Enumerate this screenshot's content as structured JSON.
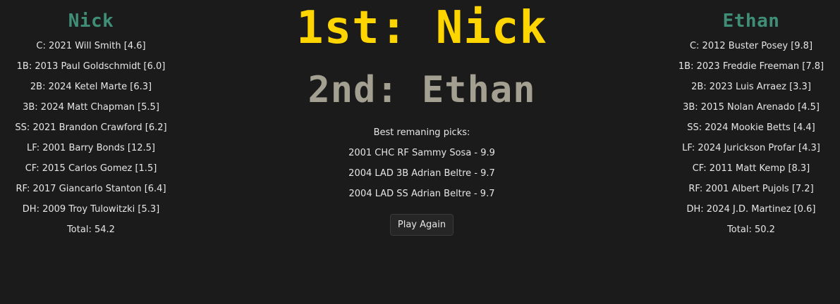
{
  "colors": {
    "background": "#1b1b1b",
    "text": "#e6e6e6",
    "player_name": "#3f8f76",
    "first_place": "#ffd500",
    "second_place": "#a3a091",
    "button_bg": "#262626"
  },
  "left_player": {
    "name": "Nick",
    "roster": [
      "C: 2021 Will Smith [4.6]",
      "1B: 2013 Paul Goldschmidt [6.0]",
      "2B: 2024 Ketel Marte [6.3]",
      "3B: 2024 Matt Chapman [5.5]",
      "SS: 2021 Brandon Crawford [6.2]",
      "LF: 2001 Barry Bonds [12.5]",
      "CF: 2015 Carlos Gomez [1.5]",
      "RF: 2017 Giancarlo Stanton [6.4]",
      "DH: 2009 Troy Tulowitzki [5.3]"
    ],
    "total": "Total: 54.2"
  },
  "right_player": {
    "name": "Ethan",
    "roster": [
      "C: 2012 Buster Posey [9.8]",
      "1B: 2023 Freddie Freeman [7.8]",
      "2B: 2023 Luis Arraez [3.3]",
      "3B: 2015 Nolan Arenado [4.5]",
      "SS: 2024 Mookie Betts [4.4]",
      "LF: 2024 Jurickson Profar [4.3]",
      "CF: 2011 Matt Kemp [8.3]",
      "RF: 2001 Albert Pujols [7.2]",
      "DH: 2024 J.D. Martinez [0.6]"
    ],
    "total": "Total: 50.2"
  },
  "results": {
    "first": "1st: Nick",
    "second": "2nd: Ethan"
  },
  "best_picks": {
    "title": "Best remaning picks:",
    "items": [
      "2001 CHC RF Sammy Sosa - 9.9",
      "2004 LAD 3B Adrian Beltre - 9.7",
      "2004 LAD SS Adrian Beltre - 9.7"
    ]
  },
  "actions": {
    "play_again_label": "Play Again"
  }
}
